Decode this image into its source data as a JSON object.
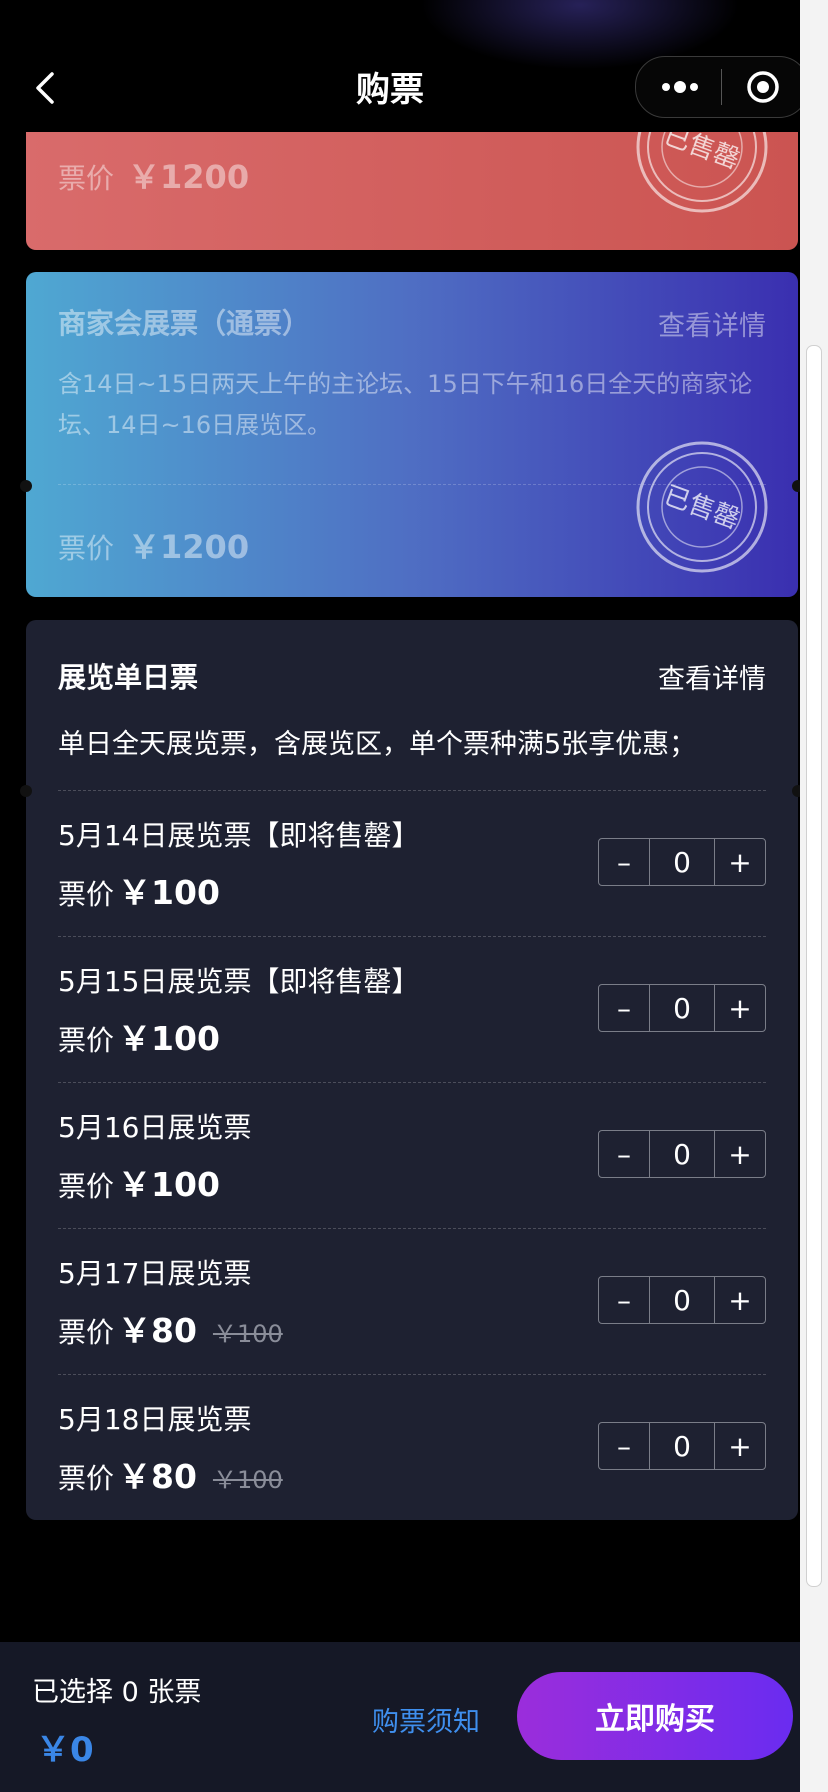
{
  "header": {
    "title": "购票"
  },
  "colors": {
    "accent": "#3f8fee",
    "buy_gradient_start": "#9b2ddb",
    "buy_gradient_end": "#6a2cf0",
    "card_red": "#cb5451",
    "card_blue_start": "#4fa8d2",
    "card_blue_end": "#3a2fb0",
    "card_dark": "#1e2131"
  },
  "card_sold1": {
    "price_label": "票价",
    "price": "￥1200",
    "stamp_text": "已售罄"
  },
  "card_sold2": {
    "title": "商家会展票（通票）",
    "detail_link": "查看详情",
    "desc": "含14日~15日两天上午的主论坛、15日下午和16日全天的商家论坛、14日~16日展览区。",
    "price_label": "票价",
    "price": "￥1200",
    "stamp_text": "已售罄"
  },
  "card_daily": {
    "title": "展览单日票",
    "detail_link": "查看详情",
    "desc": "单日全天展览票，含展览区，单个票种满5张享优惠；",
    "items": [
      {
        "name": "5月14日展览票【即将售罄】",
        "price_label": "票价",
        "price": "￥100",
        "original": "",
        "qty": "0",
        "minus": "–",
        "plus": "+"
      },
      {
        "name": "5月15日展览票【即将售罄】",
        "price_label": "票价",
        "price": "￥100",
        "original": "",
        "qty": "0",
        "minus": "–",
        "plus": "+"
      },
      {
        "name": "5月16日展览票",
        "price_label": "票价",
        "price": "￥100",
        "original": "",
        "qty": "0",
        "minus": "–",
        "plus": "+"
      },
      {
        "name": "5月17日展览票",
        "price_label": "票价",
        "price": "￥80",
        "original": "￥100",
        "qty": "0",
        "minus": "–",
        "plus": "+"
      },
      {
        "name": "5月18日展览票",
        "price_label": "票价",
        "price": "￥80",
        "original": "￥100",
        "qty": "0",
        "minus": "–",
        "plus": "+"
      }
    ]
  },
  "footer": {
    "selected_text": "已选择 0 张票",
    "total": "￥0",
    "notice_link": "购票须知",
    "buy_button": "立即购买"
  }
}
